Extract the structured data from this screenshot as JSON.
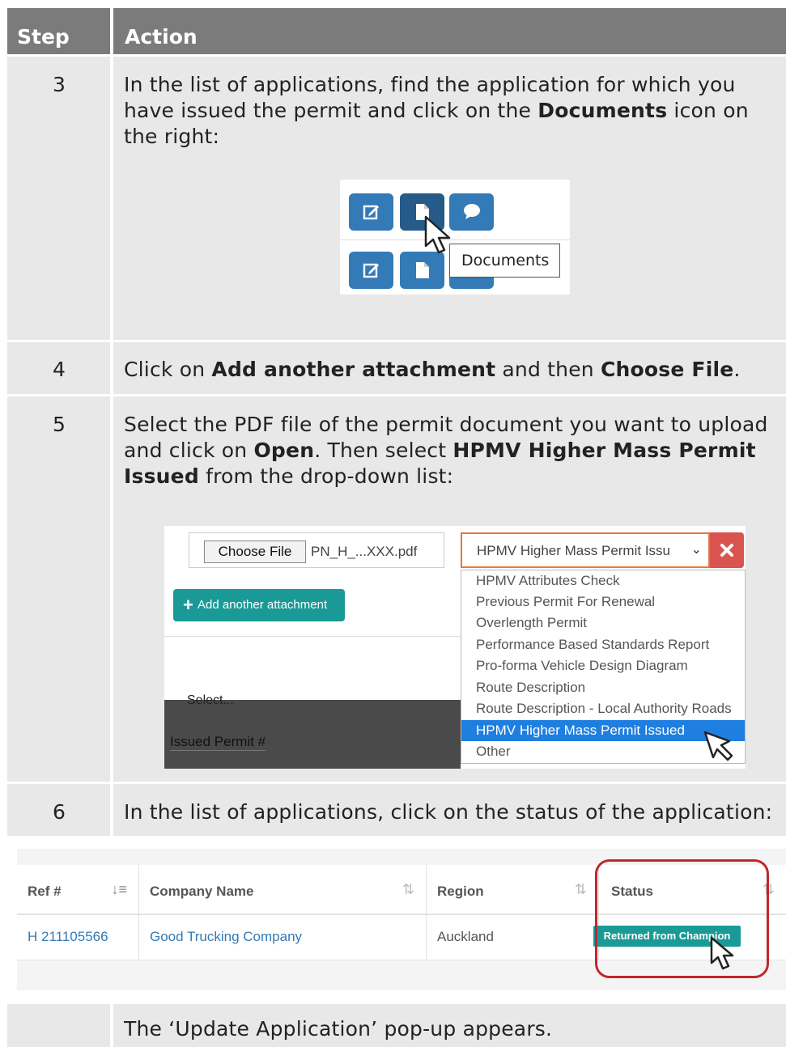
{
  "table": {
    "headers": {
      "step": "Step",
      "action": "Action"
    },
    "rows": [
      {
        "step": "3",
        "action": [
          "In the list of applications, find the application for which you have issued the permit and click on the ",
          "Documents",
          " icon on the right:"
        ]
      },
      {
        "step": "4",
        "action": [
          "Click on ",
          "Add another attachment",
          " and then ",
          "Choose File",
          "."
        ]
      },
      {
        "step": "5",
        "action": [
          "Select the PDF file of the permit document you want to upload and click on ",
          "Open",
          ". Then select ",
          "HPMV Higher Mass Permit Issued",
          " from the drop-down list:"
        ]
      },
      {
        "step": "6",
        "action": "In the list of applications, click on the status of the application:"
      }
    ],
    "footer_note": "The ‘Update Application’ pop-up appears."
  },
  "figure_documents": {
    "tooltip": "Documents",
    "icons": [
      "edit-icon",
      "document-icon",
      "comment-icon"
    ]
  },
  "figure_dropdown": {
    "choose_file_label": "Choose File",
    "file_name": "PN_H_...XXX.pdf",
    "selected_value": "HPMV Higher Mass Permit Issu",
    "add_attachment_label": "Add another attachment",
    "options": [
      "HPMV Attributes Check",
      "Previous Permit For Renewal",
      "Overlength Permit",
      "Performance Based Standards Report",
      "Pro-forma Vehicle Design Diagram",
      "Route Description",
      "Route Description - Local Authority Roads",
      "HPMV Higher Mass Permit Issued",
      "Other"
    ],
    "highlighted_index": 7,
    "partial_select_text": "Select...",
    "issued_permit_label": "Issued Permit #"
  },
  "figure_table": {
    "columns": [
      "Ref #",
      "Company Name",
      "Region",
      "Status"
    ],
    "row": {
      "ref": "H 211105566",
      "company": "Good Trucking Company",
      "region": "Auckland",
      "status": "Returned from Champion"
    }
  },
  "colors": {
    "header_bg": "#7b7b7b",
    "cell_bg": "#e8e8e8",
    "button_blue": "#337ab7",
    "teal": "#1a9a96",
    "highlight_blue": "#1e7fe0",
    "ring_red": "#c0272d"
  }
}
